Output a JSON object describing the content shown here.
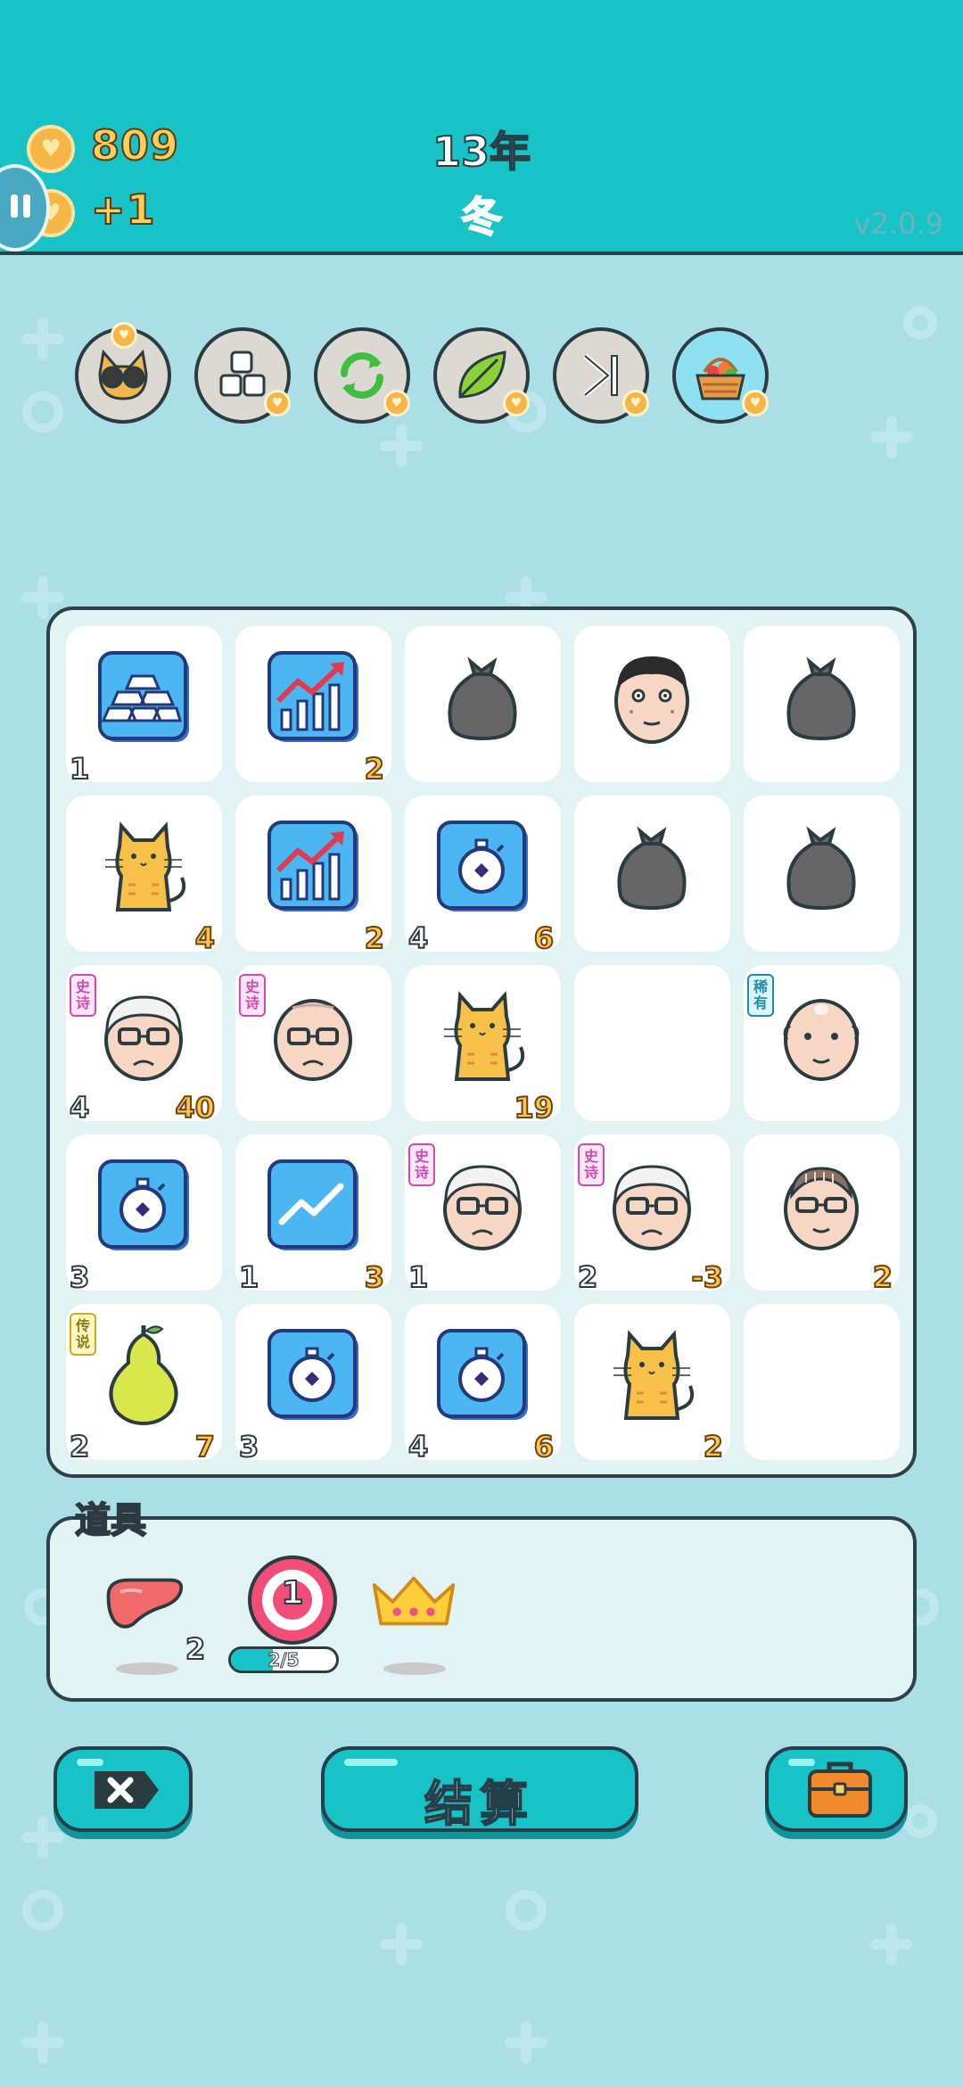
{
  "header": {
    "coins": "809",
    "coin_rate": "+1",
    "year": "13年",
    "season": "冬",
    "version": "v2.0.9"
  },
  "abilities": [
    {
      "name": "cat-glasses",
      "active": false
    },
    {
      "name": "blocks",
      "active": false
    },
    {
      "name": "refresh",
      "active": false
    },
    {
      "name": "leaf",
      "active": false
    },
    {
      "name": "skip",
      "active": false
    },
    {
      "name": "basket",
      "active": true
    }
  ],
  "board": {
    "cells": [
      {
        "item": "gold-bars",
        "left": "1",
        "right": ""
      },
      {
        "item": "stock-chart",
        "left": "",
        "right": "2"
      },
      {
        "item": "trash-bag",
        "left": "",
        "right": ""
      },
      {
        "item": "man-face",
        "left": "",
        "right": ""
      },
      {
        "item": "trash-bag",
        "left": "",
        "right": ""
      },
      {
        "item": "cat",
        "left": "",
        "right": "4"
      },
      {
        "item": "stock-chart",
        "left": "",
        "right": "2"
      },
      {
        "item": "stopwatch",
        "left": "4",
        "right": "6"
      },
      {
        "item": "trash-bag",
        "left": "",
        "right": ""
      },
      {
        "item": "trash-bag",
        "left": "",
        "right": ""
      },
      {
        "item": "grandpa",
        "tag": "史诗",
        "tag_type": "epic",
        "left": "4",
        "right": "40"
      },
      {
        "item": "bald-grandpa",
        "tag": "史诗",
        "tag_type": "epic",
        "left": "",
        "right": ""
      },
      {
        "item": "cat",
        "left": "",
        "right": "19"
      },
      {
        "item": "empty",
        "left": "",
        "right": ""
      },
      {
        "item": "bald-man",
        "tag": "稀有",
        "tag_type": "rare",
        "left": "",
        "right": ""
      },
      {
        "item": "stopwatch",
        "left": "3",
        "right": ""
      },
      {
        "item": "trend",
        "left": "1",
        "right": "3"
      },
      {
        "item": "grandpa",
        "tag": "史诗",
        "tag_type": "epic",
        "left": "1",
        "right": ""
      },
      {
        "item": "grandpa",
        "tag": "史诗",
        "tag_type": "epic",
        "left": "2",
        "right": "-3"
      },
      {
        "item": "old-man-glasses",
        "left": "",
        "right": "2"
      },
      {
        "item": "pear",
        "tag": "传说",
        "tag_type": "legend",
        "left": "2",
        "right": "7"
      },
      {
        "item": "stopwatch",
        "left": "3",
        "right": ""
      },
      {
        "item": "stopwatch",
        "left": "4",
        "right": "6"
      },
      {
        "item": "cat",
        "left": "",
        "right": "2"
      },
      {
        "item": "empty",
        "left": "",
        "right": ""
      }
    ]
  },
  "props": {
    "title": "道具",
    "liver_count": "2",
    "target_number": "1",
    "target_progress": "2/5",
    "target_fraction": 0.4
  },
  "buttons": {
    "settle": "结算"
  },
  "colors": {
    "teal": "#17c3c7",
    "background": "#a9dfe5",
    "outline": "#2c4248",
    "gold": "#ffc54a",
    "epic": "#d44ab0",
    "rare": "#1b8fb0"
  }
}
